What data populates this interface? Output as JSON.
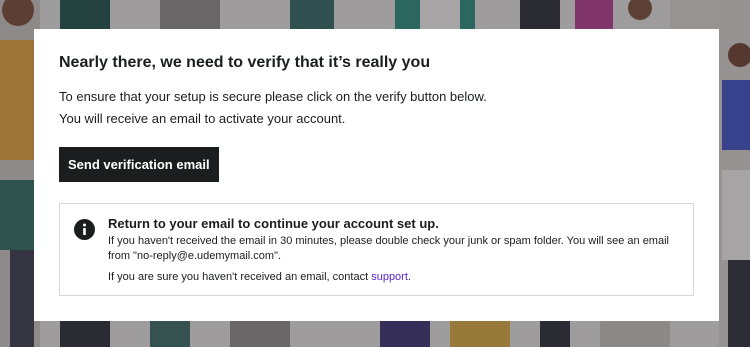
{
  "modal": {
    "title": "Nearly there, we need to verify that it’s really you",
    "description_line1": "To ensure that your setup is secure please click on the verify button below.",
    "description_line2": "You will receive an email to activate your account.",
    "button_label": "Send verification email"
  },
  "alert": {
    "icon": "info-icon",
    "title": "Return to your email to continue your account set up.",
    "body": "If you haven't received the email in 30 minutes, please double check your junk or spam folder. You will see an email from \"no-reply@e.udemymail.com\".",
    "support_prefix": "If you are sure you haven't received an email, contact ",
    "support_link": "support",
    "support_suffix": "."
  },
  "colors": {
    "button_bg": "#1c1d1f",
    "link": "#5624d0",
    "alert_border": "#d1d7dc"
  }
}
